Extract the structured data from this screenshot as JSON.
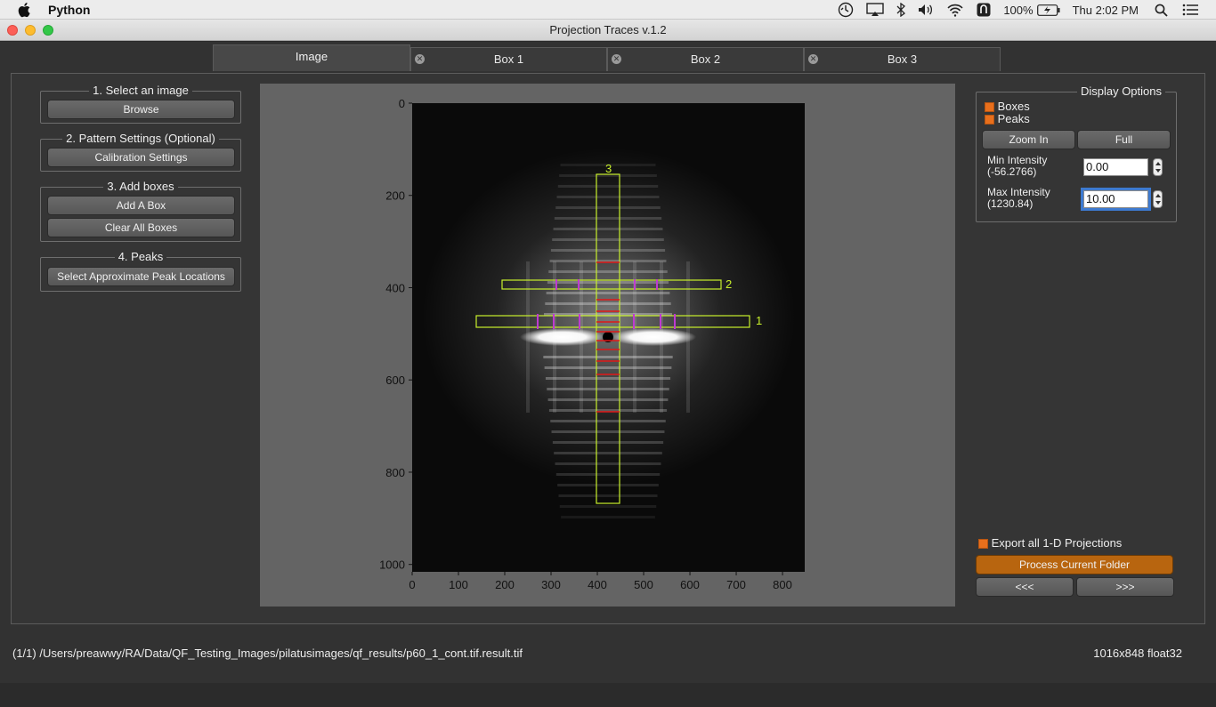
{
  "menubar": {
    "app_name": "Python",
    "battery": "100%",
    "clock": "Thu 2:02 PM"
  },
  "window": {
    "title": "Projection Traces v.1.2"
  },
  "tabs": [
    {
      "label": "Image",
      "active": true
    },
    {
      "label": "Box 1",
      "active": false
    },
    {
      "label": "Box 2",
      "active": false
    },
    {
      "label": "Box 3",
      "active": false
    }
  ],
  "left": {
    "select_image": {
      "title": "1. Select an image",
      "browse": "Browse"
    },
    "pattern": {
      "title": "2. Pattern Settings (Optional)",
      "calibration": "Calibration Settings"
    },
    "boxes": {
      "title": "3. Add boxes",
      "add": "Add A Box",
      "clear": "Clear All Boxes"
    },
    "peaks": {
      "title": "4. Peaks",
      "select": "Select Approximate Peak Locations"
    }
  },
  "plot": {
    "x_ticks": [
      "0",
      "100",
      "200",
      "300",
      "400",
      "500",
      "600",
      "700",
      "800"
    ],
    "y_ticks": [
      "0",
      "200",
      "400",
      "600",
      "800",
      "1000"
    ],
    "box_labels": [
      "1",
      "2",
      "3"
    ],
    "box_color": "#c8f02c",
    "ring_color": "#e01818",
    "peak_color": "#c03ad0"
  },
  "display": {
    "title": "Display Options",
    "boxes": "Boxes",
    "peaks": "Peaks",
    "zoom_in": "Zoom In",
    "full": "Full",
    "min_label": "Min Intensity",
    "min_range": "(-56.2766)",
    "min_value": "0.00",
    "max_label": "Max Intensity",
    "max_range": "(1230.84)",
    "max_value": "10.00"
  },
  "export": {
    "label": "Export all 1-D Projections",
    "process": "Process Current Folder",
    "prev": "<<<",
    "next": ">>>"
  },
  "status": {
    "path": "(1/1) /Users/preawwy/RA/Data/QF_Testing_Images/pilatusimages/qf_results/p60_1_cont.tif.result.tif",
    "info": "1016x848 float32"
  },
  "colors": {
    "accent": "#e86f1c",
    "process_button": "#b8650f"
  }
}
